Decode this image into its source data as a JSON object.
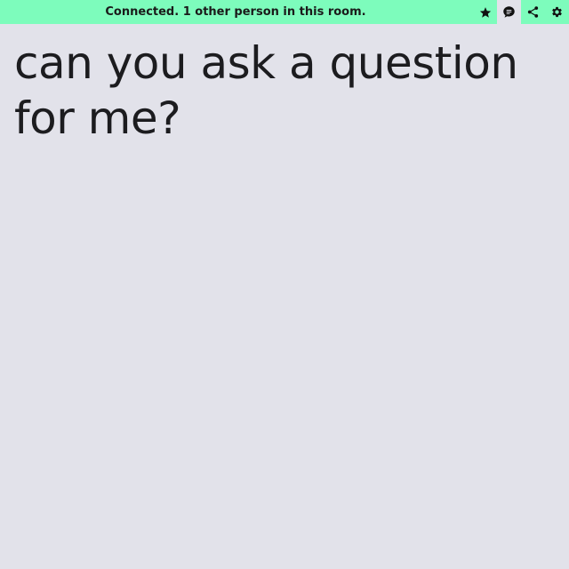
{
  "status_bar": {
    "message": "Connected. 1 other person in this room."
  },
  "toolbar": {
    "items": [
      {
        "icon": "star-icon"
      },
      {
        "icon": "chat-icon",
        "active": true
      },
      {
        "icon": "share-icon"
      },
      {
        "icon": "gear-icon"
      }
    ]
  },
  "editor": {
    "text": "can you ask a question for me?"
  },
  "colors": {
    "status_bar_bg": "#7dfcbc",
    "page_bg": "#e2e2ea",
    "text": "#1c1c1f"
  }
}
